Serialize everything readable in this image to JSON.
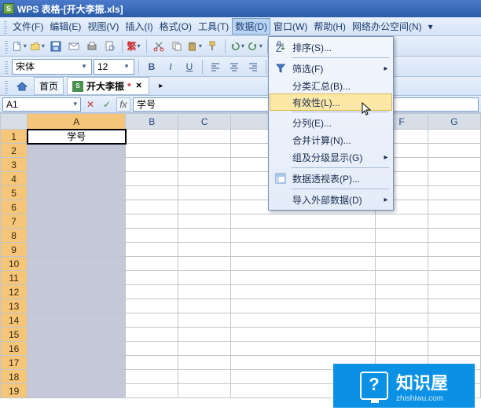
{
  "title": {
    "app": "WPS 表格",
    "sep": " - ",
    "doc": "[开大李振.xls]"
  },
  "menus": {
    "file": "文件(F)",
    "edit": "编辑(E)",
    "view": "视图(V)",
    "insert": "插入(I)",
    "format": "格式(O)",
    "tools": "工具(T)",
    "data": "数据(D)",
    "window": "窗口(W)",
    "help": "帮助(H)",
    "net": "网络办公空间(N)"
  },
  "tabs": {
    "home": "首页",
    "docname": "开大李振",
    "star": "*"
  },
  "fx": {
    "cell": "A1",
    "label": "fx",
    "value": "学号"
  },
  "format": {
    "font": "宋体",
    "size": "12",
    "bold": "B",
    "italic": "I",
    "underline": "U"
  },
  "dropdown": {
    "sort": "排序(S)...",
    "filter": "筛选(F)",
    "subtotal": "分类汇总(B)...",
    "validation": "有效性(L)...",
    "texttocolumns": "分列(E)...",
    "consolidate": "合并计算(N)...",
    "group": "组及分级显示(G)",
    "pivot": "数据透视表(P)...",
    "import": "导入外部数据(D)"
  },
  "cols": {
    "A": "A",
    "B": "B",
    "C": "C",
    "F": "F",
    "G": "G"
  },
  "rows": [
    "1",
    "2",
    "3",
    "4",
    "5",
    "6",
    "7",
    "8",
    "9",
    "10",
    "11",
    "12",
    "13",
    "14",
    "15",
    "16",
    "17",
    "18",
    "19"
  ],
  "cellA1": "学号",
  "watermark": {
    "name": "知识屋",
    "url": "zhishiwu.com"
  }
}
